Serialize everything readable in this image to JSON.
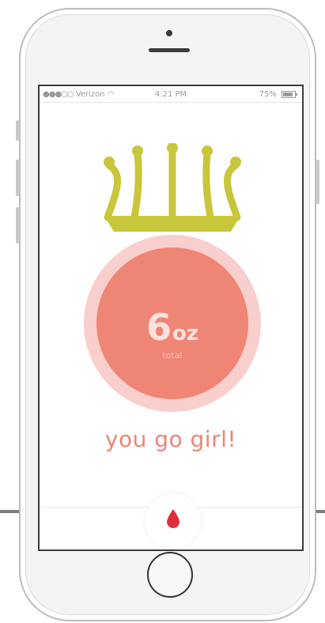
{
  "status_bar": {
    "carrier": "Verizon",
    "time": "4:21 PM",
    "battery": "75%",
    "battery_level": 0.75,
    "signal_dots": "●●●○○"
  },
  "tracker": {
    "amount": "6",
    "unit": "oz",
    "label": "total"
  },
  "message": "you go girl!",
  "icons": {
    "crown": "crown-icon",
    "drop": "water-drop-icon"
  },
  "colors": {
    "accent": "#ef8574",
    "ring": "#f8cfcc",
    "crown": "#c8c63a",
    "drop": "#e02f3c"
  }
}
